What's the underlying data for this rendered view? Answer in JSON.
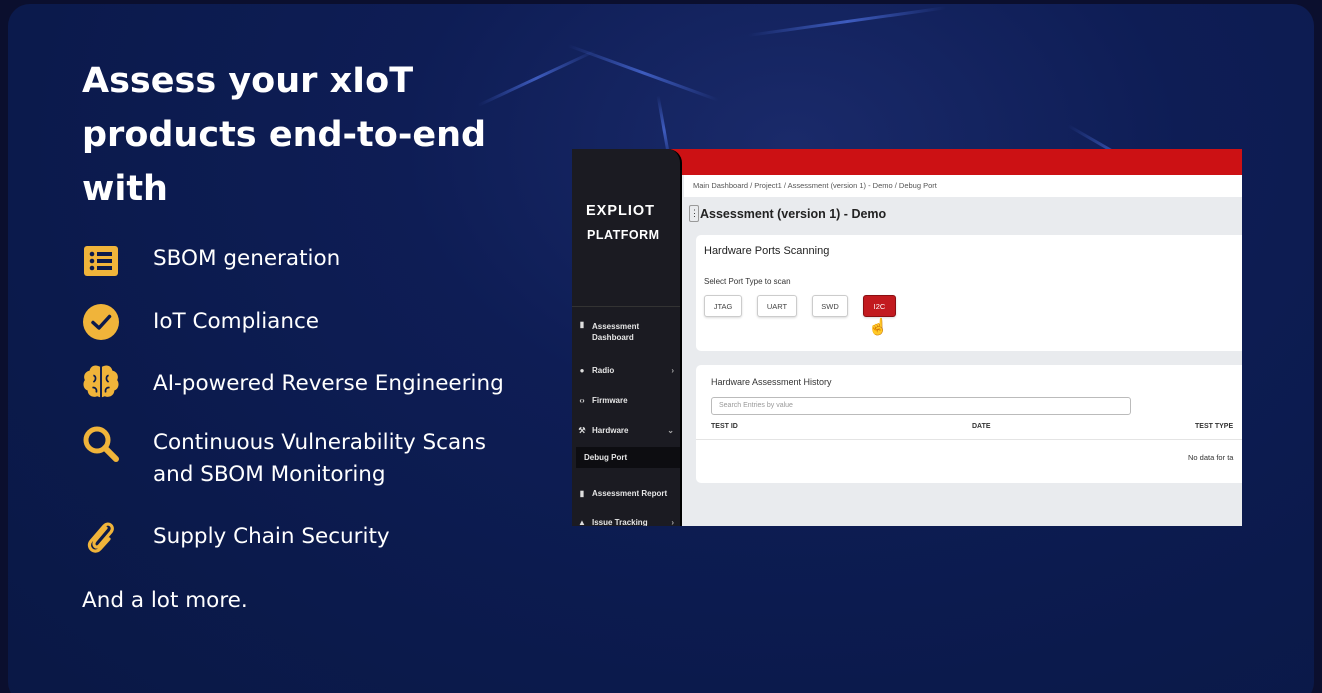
{
  "headline": "Assess your xIoT products end-to-end with",
  "features": [
    {
      "icon": "list-icon",
      "label": "SBOM generation"
    },
    {
      "icon": "check-circle-icon",
      "label": "IoT Compliance"
    },
    {
      "icon": "brain-icon",
      "label": "AI-powered Reverse Engineering"
    },
    {
      "icon": "search-icon",
      "label": "Continuous Vulnerability Scans and SBOM Monitoring"
    },
    {
      "icon": "paperclip-icon",
      "label": "Supply Chain Security"
    }
  ],
  "more": "And a lot more.",
  "colors": {
    "accent": "#f0b43a",
    "background": "#0b1a4c",
    "brand_red": "#cc1114"
  },
  "screenshot": {
    "logo_line1": "EXPLIOT",
    "logo_line2": "PLATFORM",
    "sidebar": [
      {
        "label": "Assessment Dashboard",
        "icon": "document-icon"
      },
      {
        "label": "Radio",
        "icon": "radio-icon"
      },
      {
        "label": "Firmware",
        "icon": "code-icon"
      },
      {
        "label": "Hardware",
        "icon": "hammer-icon"
      },
      {
        "label": "Debug Port",
        "icon": ""
      },
      {
        "label": "Assessment Report",
        "icon": "document-icon"
      },
      {
        "label": "Issue Tracking",
        "icon": "bug-icon"
      }
    ],
    "breadcrumb": "Main Dashboard / Project1 / Assessment (version 1) - Demo / Debug Port",
    "page_title": "Assessment (version 1) - Demo",
    "scan": {
      "title": "Hardware Ports Scanning",
      "subtitle": "Select Port Type to scan",
      "ports": [
        "JTAG",
        "UART",
        "SWD",
        "I2C"
      ],
      "selected": "I2C"
    },
    "history": {
      "title": "Hardware Assessment History",
      "search_placeholder": "Search Entries by value",
      "columns": [
        "TEST ID",
        "DATE",
        "TEST TYPE"
      ],
      "empty": "No data for ta"
    }
  }
}
